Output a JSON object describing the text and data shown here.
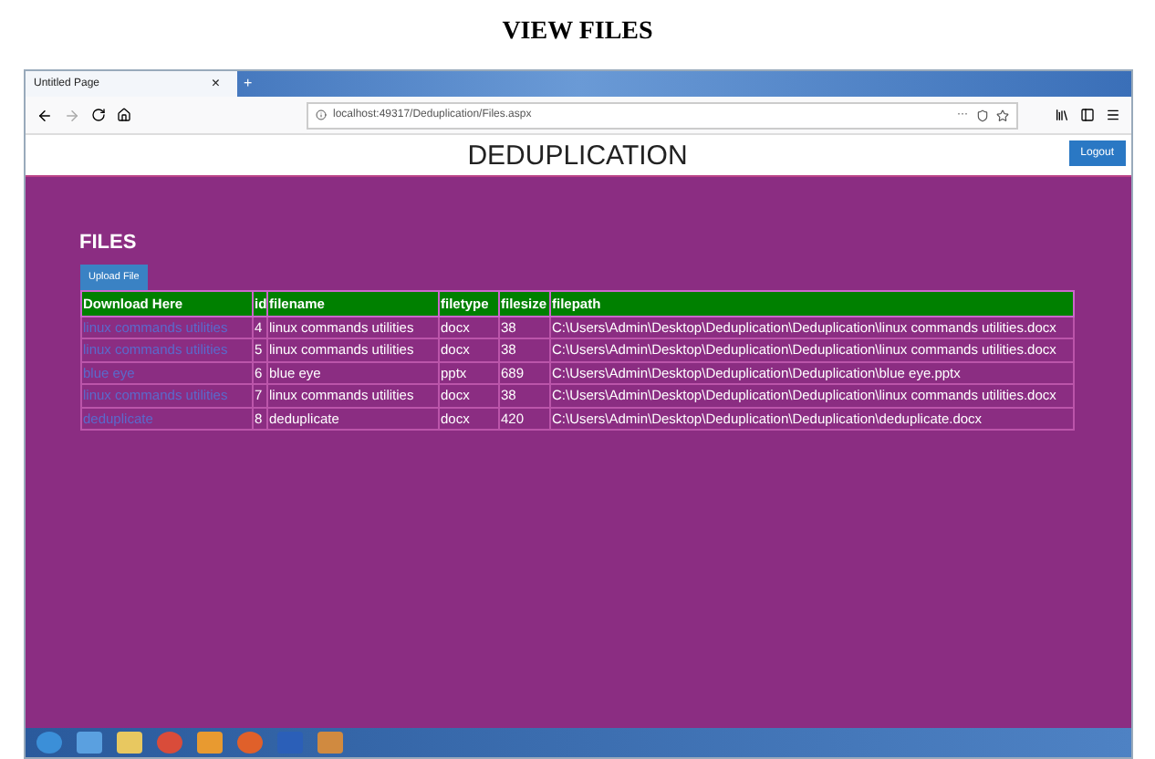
{
  "page_heading": "VIEW FILES",
  "browser": {
    "tab_title": "Untitled Page",
    "tab_close": "×",
    "new_tab": "+",
    "address": "localhost:49317/Deduplication/Files.aspx",
    "address_menu": "···"
  },
  "header": {
    "title": "DEDUPLICATION",
    "logout": "Logout"
  },
  "section_title": "FILES",
  "upload_button": "Upload File",
  "table": {
    "columns": [
      "Download Here",
      "id",
      "filename",
      "filetype",
      "filesize",
      "filepath"
    ],
    "rows": [
      {
        "download": "linux commands utilities",
        "id": "4",
        "filename": "linux commands utilities",
        "filetype": "docx",
        "filesize": "38",
        "filepath": "C:\\Users\\Admin\\Desktop\\Deduplication\\Deduplication\\linux commands utilities.docx"
      },
      {
        "download": "linux commands utilities",
        "id": "5",
        "filename": "linux commands utilities",
        "filetype": "docx",
        "filesize": "38",
        "filepath": "C:\\Users\\Admin\\Desktop\\Deduplication\\Deduplication\\linux commands utilities.docx"
      },
      {
        "download": "blue eye",
        "id": "6",
        "filename": "blue eye",
        "filetype": "pptx",
        "filesize": "689",
        "filepath": "C:\\Users\\Admin\\Desktop\\Deduplication\\Deduplication\\blue eye.pptx"
      },
      {
        "download": "linux commands utilities",
        "id": "7",
        "filename": "linux commands utilities",
        "filetype": "docx",
        "filesize": "38",
        "filepath": "C:\\Users\\Admin\\Desktop\\Deduplication\\Deduplication\\linux commands utilities.docx"
      },
      {
        "download": "deduplicate",
        "id": "8",
        "filename": "deduplicate",
        "filetype": "docx",
        "filesize": "420",
        "filepath": "C:\\Users\\Admin\\Desktop\\Deduplication\\Deduplication\\deduplicate.docx"
      }
    ]
  }
}
